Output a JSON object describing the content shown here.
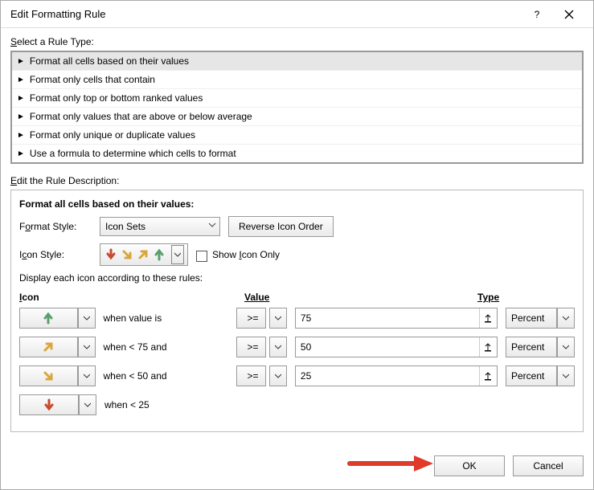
{
  "titlebar": {
    "title": "Edit Formatting Rule",
    "help_label": "?",
    "close_label": "✕"
  },
  "rule_type_section": {
    "label": "Select a Rule Type:"
  },
  "rule_types": [
    {
      "label": "Format all cells based on their values",
      "selected": true
    },
    {
      "label": "Format only cells that contain",
      "selected": false
    },
    {
      "label": "Format only top or bottom ranked values",
      "selected": false
    },
    {
      "label": "Format only values that are above or below average",
      "selected": false
    },
    {
      "label": "Format only unique or duplicate values",
      "selected": false
    },
    {
      "label": "Use a formula to determine which cells to format",
      "selected": false
    }
  ],
  "desc_section": {
    "label": "Edit the Rule Description:",
    "heading": "Format all cells based on their values:"
  },
  "format_style": {
    "label": "Format Style:",
    "value": "Icon Sets"
  },
  "reverse_button": {
    "label": "Reverse Icon Order"
  },
  "show_icon_only": {
    "label": "Show Icon Only",
    "checked": false
  },
  "icon_style": {
    "label": "Icon Style:"
  },
  "display_rules_label": "Display each icon according to these rules:",
  "headers": {
    "icon": "Icon",
    "value": "Value",
    "type": "Type"
  },
  "rules": [
    {
      "icon": "arrow-up-green",
      "when": "when value is",
      "op": ">=",
      "value": "75",
      "type": "Percent"
    },
    {
      "icon": "arrow-upright-yellow",
      "when": "when < 75 and",
      "op": ">=",
      "value": "50",
      "type": "Percent"
    },
    {
      "icon": "arrow-downright-yellow",
      "when": "when < 50 and",
      "op": ">=",
      "value": "25",
      "type": "Percent"
    },
    {
      "icon": "arrow-down-red",
      "when": "when < 25",
      "op": "",
      "value": "",
      "type": ""
    }
  ],
  "footer": {
    "ok": "OK",
    "cancel": "Cancel"
  },
  "icons": {
    "arrow-down-red": "#c94a2f",
    "arrow-downright-yellow": "#d9a63a",
    "arrow-upright-yellow": "#d9a63a",
    "arrow-up-green": "#5a9e6f"
  }
}
